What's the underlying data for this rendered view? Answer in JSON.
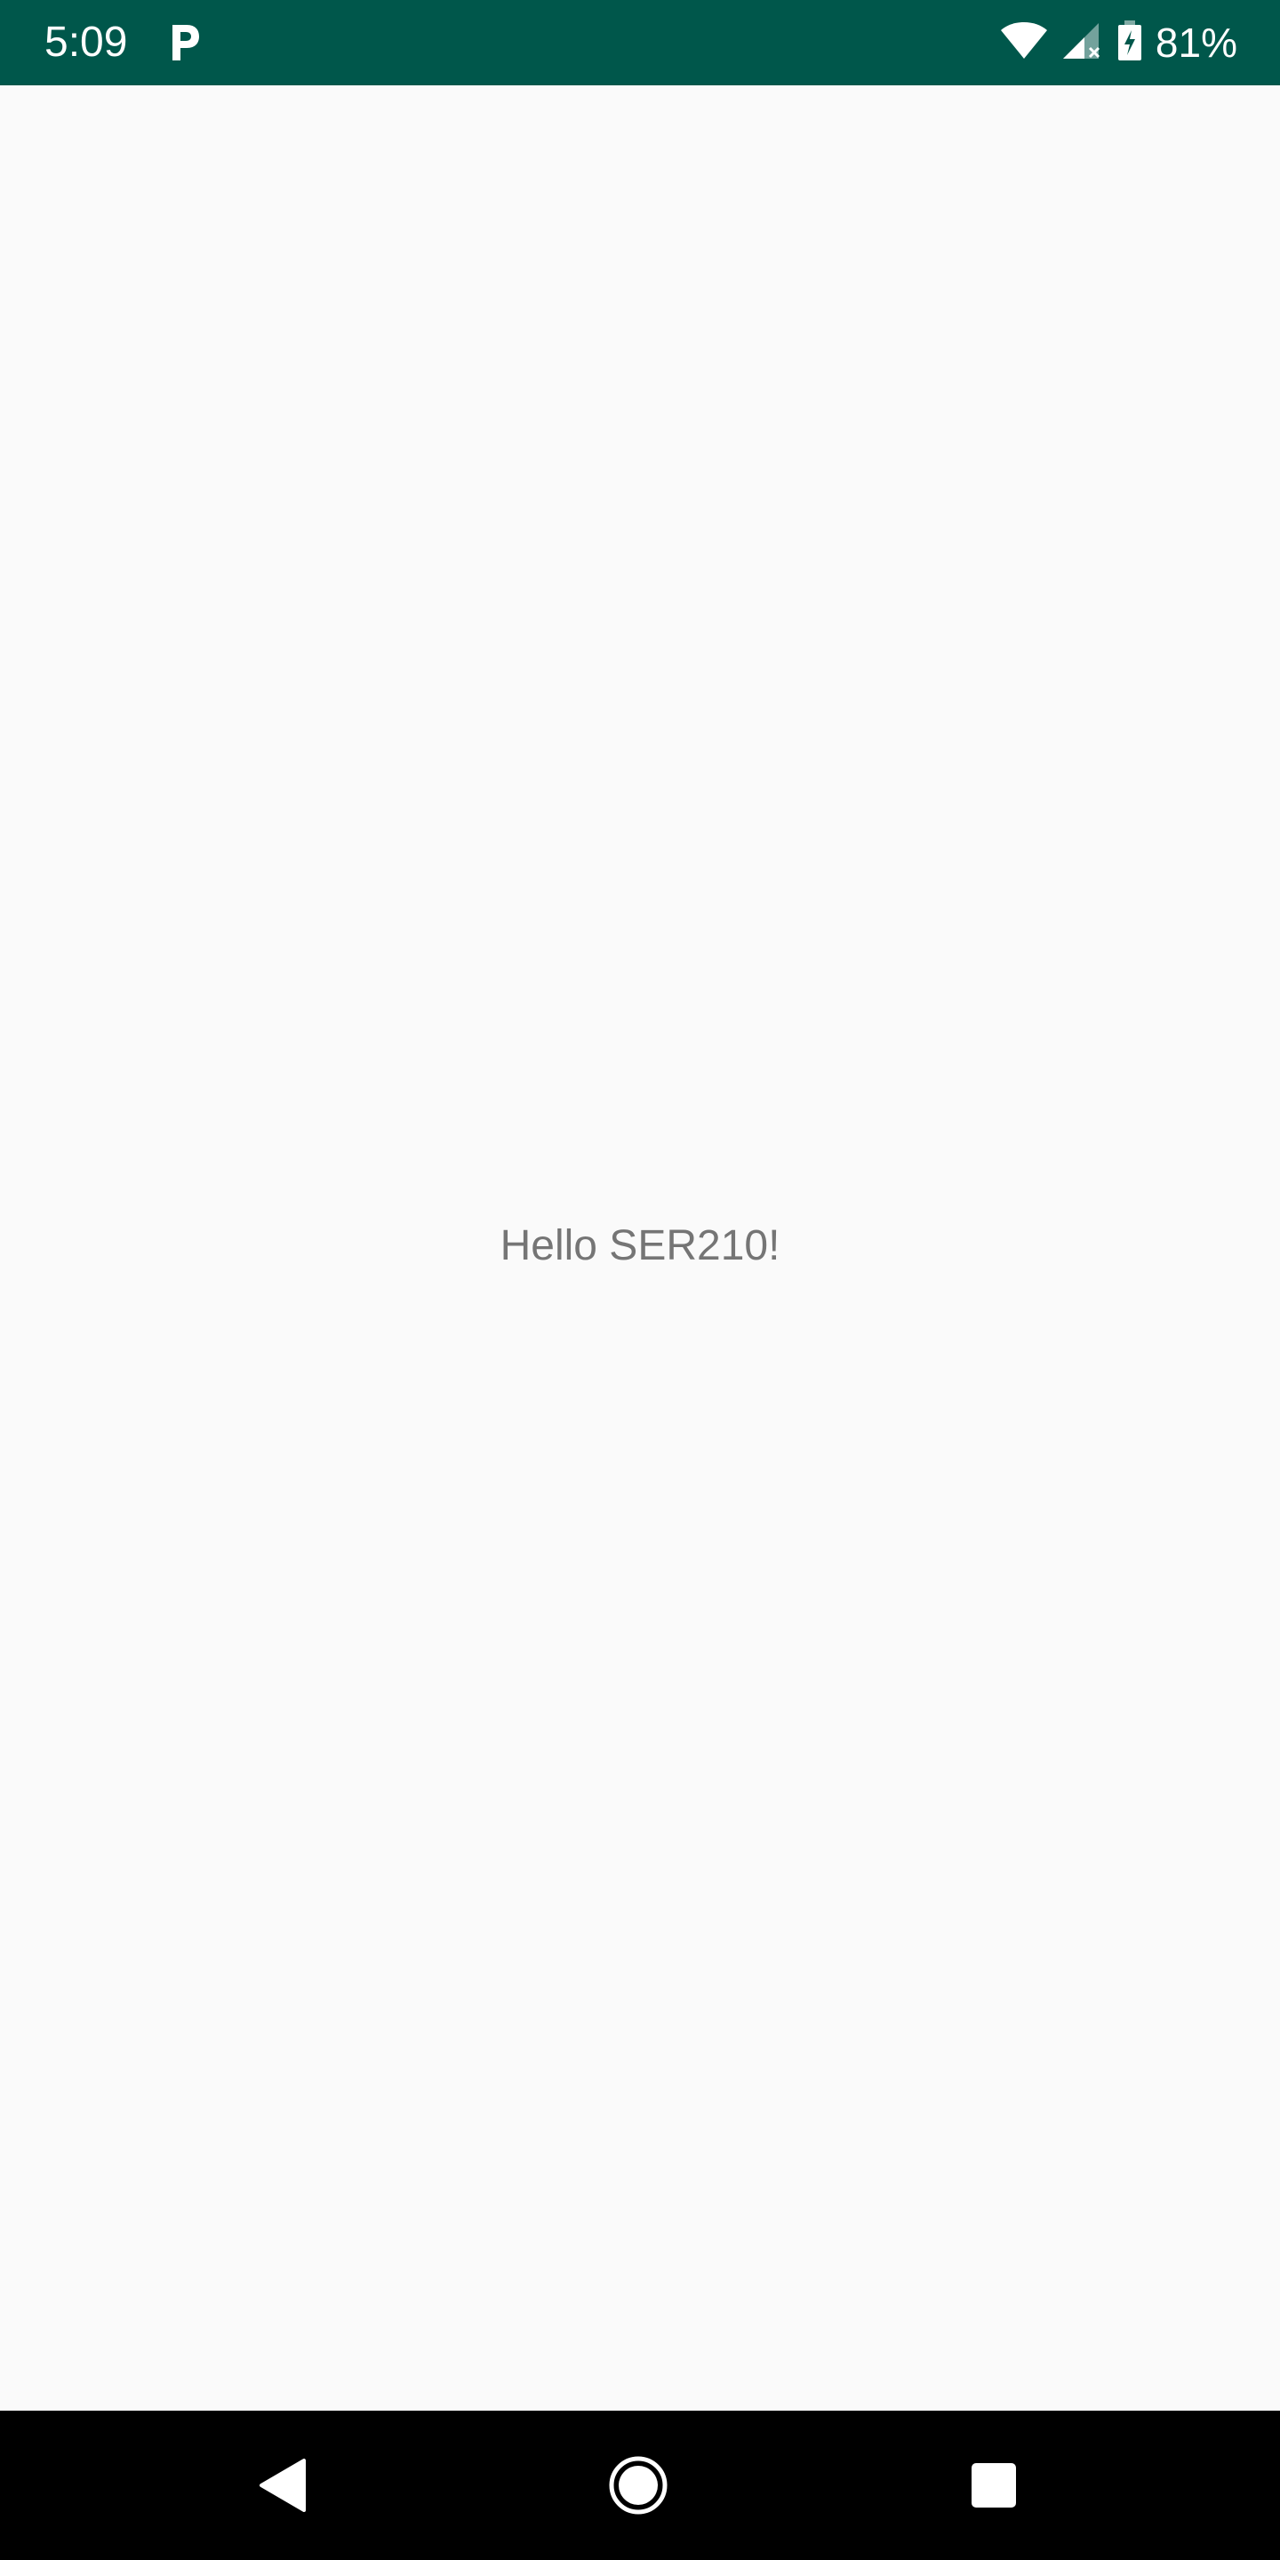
{
  "status_bar": {
    "time": "5:09",
    "notification_icon": "parking-p-icon",
    "wifi_icon": "wifi-icon",
    "signal_icon": "cell-signal-no-service-icon",
    "battery_icon": "battery-charging-icon",
    "battery_percent": "81%",
    "background_color": "#00574b"
  },
  "main": {
    "message": "Hello SER210!",
    "background_color": "#fafafa",
    "text_color": "#757575"
  },
  "nav_bar": {
    "back_icon": "back-triangle-icon",
    "home_icon": "home-circle-icon",
    "recents_icon": "recents-square-icon",
    "background_color": "#000000"
  }
}
